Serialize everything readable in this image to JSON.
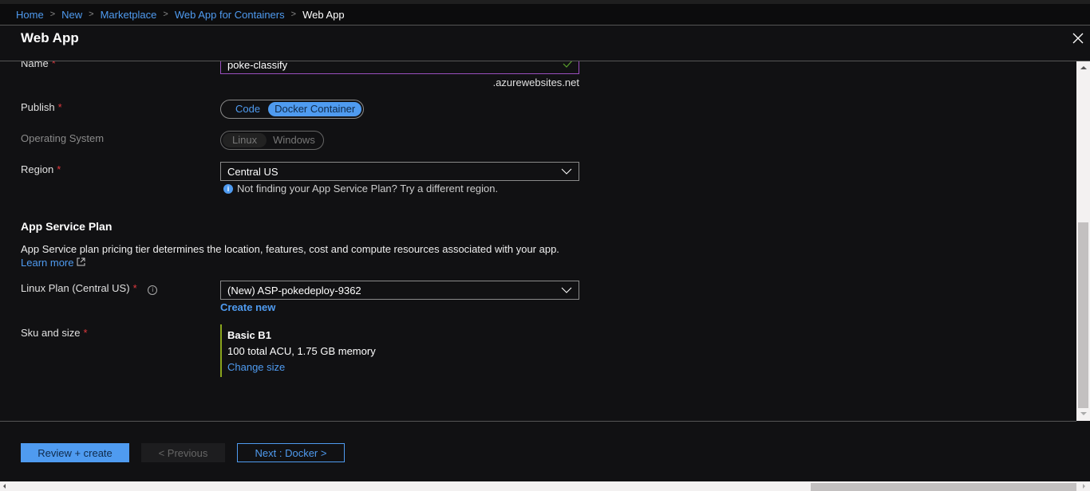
{
  "breadcrumb": [
    "Home",
    "New",
    "Marketplace",
    "Web App for Containers"
  ],
  "breadcrumb_current": "Web App",
  "title": "Web App",
  "form": {
    "name_label": "Name",
    "name_value": "poke-classify",
    "name_suffix": ".azurewebsites.net",
    "publish_label": "Publish",
    "publish_options": [
      "Code",
      "Docker Container"
    ],
    "publish_selected": "Docker Container",
    "os_label": "Operating System",
    "os_options": [
      "Linux",
      "Windows"
    ],
    "os_selected": "Linux",
    "region_label": "Region",
    "region_value": "Central US",
    "region_hint": "Not finding your App Service Plan? Try a different region.",
    "asp_heading": "App Service Plan",
    "asp_desc": "App Service plan pricing tier determines the location, features, cost and compute resources associated with your app.",
    "learn_more": "Learn more",
    "plan_label": "Linux Plan (Central US)",
    "plan_value": "(New) ASP-pokedeploy-9362",
    "create_new": "Create new",
    "sku_label": "Sku and size",
    "sku_name": "Basic B1",
    "sku_desc": "100 total ACU, 1.75 GB memory",
    "change_size": "Change size",
    "required_mark": "*"
  },
  "footer": {
    "review": "Review + create",
    "previous": "< Previous",
    "next": "Next : Docker >"
  },
  "colors": {
    "accent": "#4f9bf0",
    "required": "#e0393e",
    "sku_bar": "#8aa51d",
    "name_border": "#9b4fbf"
  }
}
